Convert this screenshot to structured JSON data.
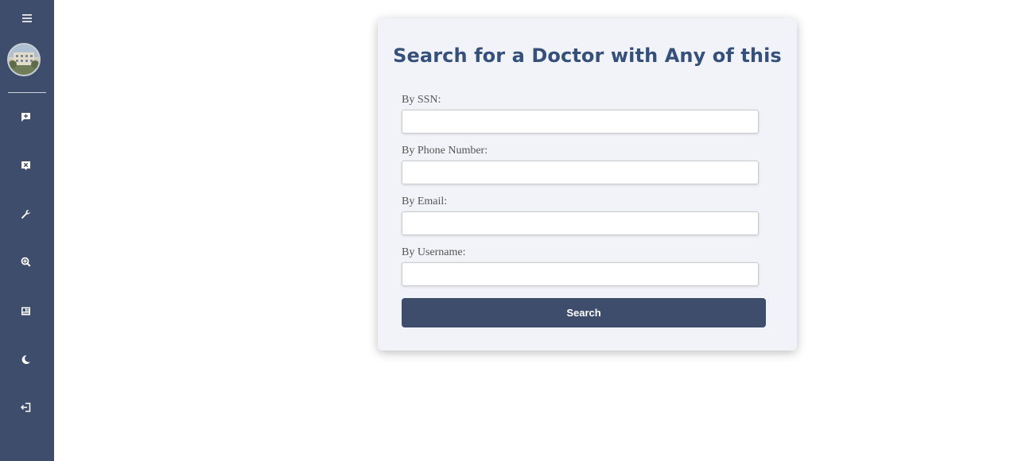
{
  "colors": {
    "sidebar_bg": "#3d4d6b",
    "title": "#35507a",
    "card_bg": "#f2f3f8",
    "button_bg": "#3d4d6b"
  },
  "sidebar": {
    "items": [
      {
        "icon": "add-comment-icon"
      },
      {
        "icon": "cancel-comment-icon"
      },
      {
        "icon": "wrench-icon"
      },
      {
        "icon": "search-icon"
      },
      {
        "icon": "id-card-icon"
      },
      {
        "icon": "moon-icon"
      },
      {
        "icon": "logout-icon"
      }
    ]
  },
  "form": {
    "title": "Search for a Doctor with Any of this",
    "fields": [
      {
        "label": "By SSN:",
        "value": "",
        "placeholder": ""
      },
      {
        "label": "By Phone Number:",
        "value": "",
        "placeholder": ""
      },
      {
        "label": "By Email:",
        "value": "",
        "placeholder": ""
      },
      {
        "label": "By Username:",
        "value": "",
        "placeholder": ""
      }
    ],
    "submit_label": "Search"
  }
}
